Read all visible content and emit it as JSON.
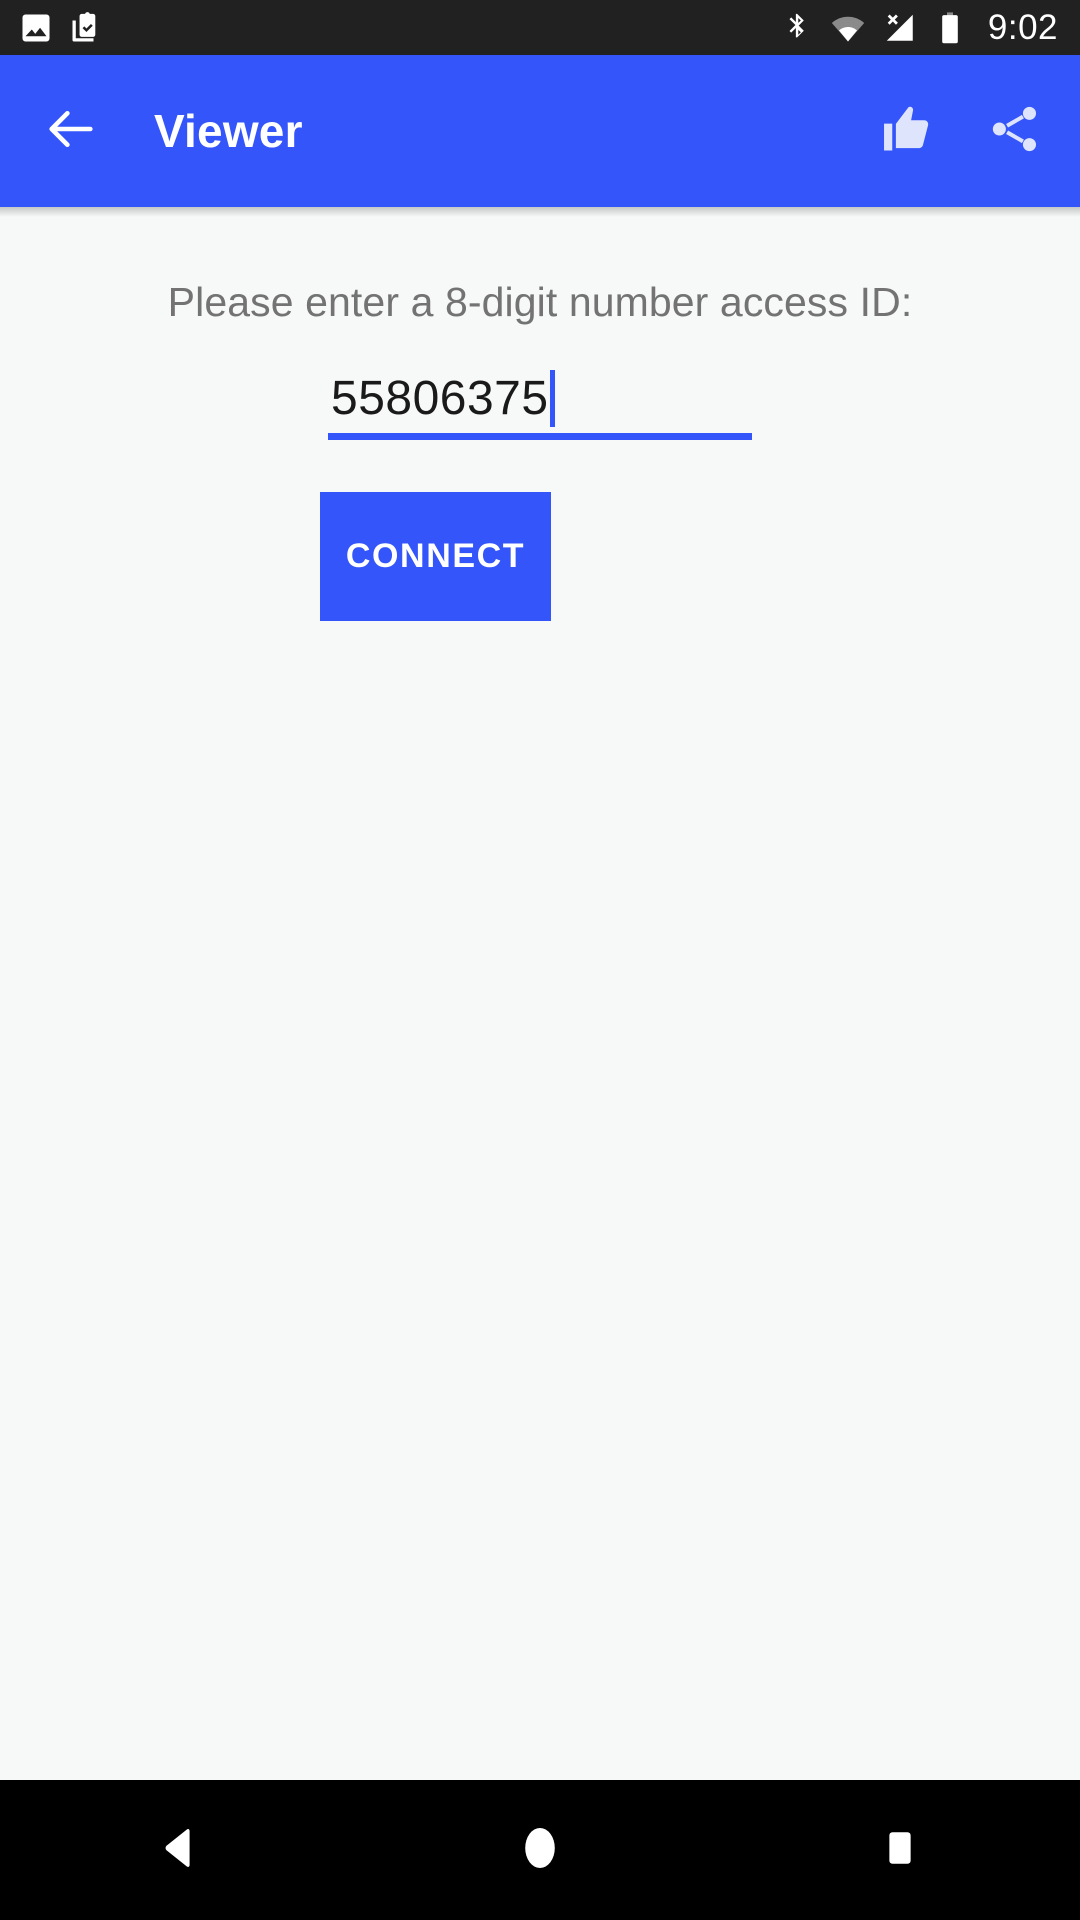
{
  "status_bar": {
    "time": "9:02",
    "left_icons": [
      {
        "name": "image-icon",
        "label": "Image"
      },
      {
        "name": "clipboard-check-icon",
        "label": "Clipboard"
      }
    ],
    "right_icons": [
      {
        "name": "bluetooth-icon",
        "label": "Bluetooth"
      },
      {
        "name": "wifi-icon",
        "label": "Wi-Fi"
      },
      {
        "name": "cellular-no-sim-icon",
        "label": "No SIM"
      },
      {
        "name": "battery-full-icon",
        "label": "Battery full"
      }
    ],
    "background": "#212121"
  },
  "app_bar": {
    "title": "Viewer",
    "back_icon": "arrow-back-icon",
    "actions": [
      {
        "name": "thumb-up-icon",
        "label": "Like"
      },
      {
        "name": "share-icon",
        "label": "Share"
      }
    ],
    "background": "#3355fa",
    "title_color": "#ffffff"
  },
  "main": {
    "prompt": "Please enter a 8-digit number access ID:",
    "access_id_field": {
      "value": "55806375",
      "placeholder": "",
      "underline_color": "#3355fa",
      "caret_color": "#3355fa"
    },
    "connect_button": {
      "label": "CONNECT",
      "background": "#3355fa",
      "text_color": "#ffffff"
    },
    "background": "#f7f8f8",
    "prompt_color": "#737373"
  },
  "nav_bar": {
    "buttons": [
      {
        "name": "nav-back-button",
        "label": "Back"
      },
      {
        "name": "nav-home-button",
        "label": "Home"
      },
      {
        "name": "nav-recents-button",
        "label": "Recents"
      }
    ],
    "background": "#000000"
  }
}
